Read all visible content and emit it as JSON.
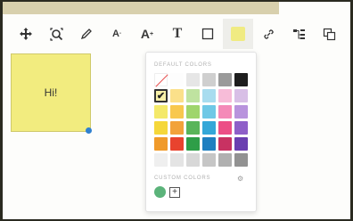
{
  "toolbar": {
    "items": [
      {
        "name": "move-tool",
        "glyph": "✥"
      },
      {
        "name": "zoom-tool",
        "glyph": "⌕"
      },
      {
        "name": "pen-tool",
        "glyph": "✎"
      },
      {
        "name": "text-smaller",
        "glyph": "A"
      },
      {
        "name": "text-bigger",
        "glyph": "A"
      },
      {
        "name": "text-tool",
        "glyph": "T"
      },
      {
        "name": "shape-tool",
        "glyph": "☐"
      },
      {
        "name": "fill-color",
        "glyph": ""
      },
      {
        "name": "link-tool",
        "glyph": "🔗"
      },
      {
        "name": "branch-tool",
        "glyph": "⇶"
      },
      {
        "name": "duplicate-tool",
        "glyph": "⧉"
      }
    ]
  },
  "note": {
    "text": "Hi!"
  },
  "color_picker": {
    "default_label": "DEFAULT COLORS",
    "custom_label": "CUSTOM COLORS",
    "add_label": "+",
    "swatches": [
      "#ffffff",
      "#fdfdfd",
      "#e6e6e6",
      "#cfcfcf",
      "#9a9a9a",
      "#1e1e1e",
      "#f7f0a8",
      "#fbe08a",
      "#bfe3a0",
      "#a8dcef",
      "#f7bcd8",
      "#d8bfe6",
      "#f4e96a",
      "#f8c84e",
      "#9fd56c",
      "#6fc8e6",
      "#f48ab8",
      "#b893dd",
      "#f5d73a",
      "#f2a23a",
      "#59b55a",
      "#34a7d8",
      "#ec4f86",
      "#8e5fc8",
      "#f09a2a",
      "#e8432e",
      "#2e9e48",
      "#1f7fc0",
      "#c83262",
      "#6a3fb0",
      "#efefef",
      "#e4e4e4",
      "#d8d8d8",
      "#c6c6c6",
      "#b0b0b0",
      "#929292"
    ],
    "selected_index": 6,
    "custom_colors": [
      "#5bb37a"
    ]
  }
}
